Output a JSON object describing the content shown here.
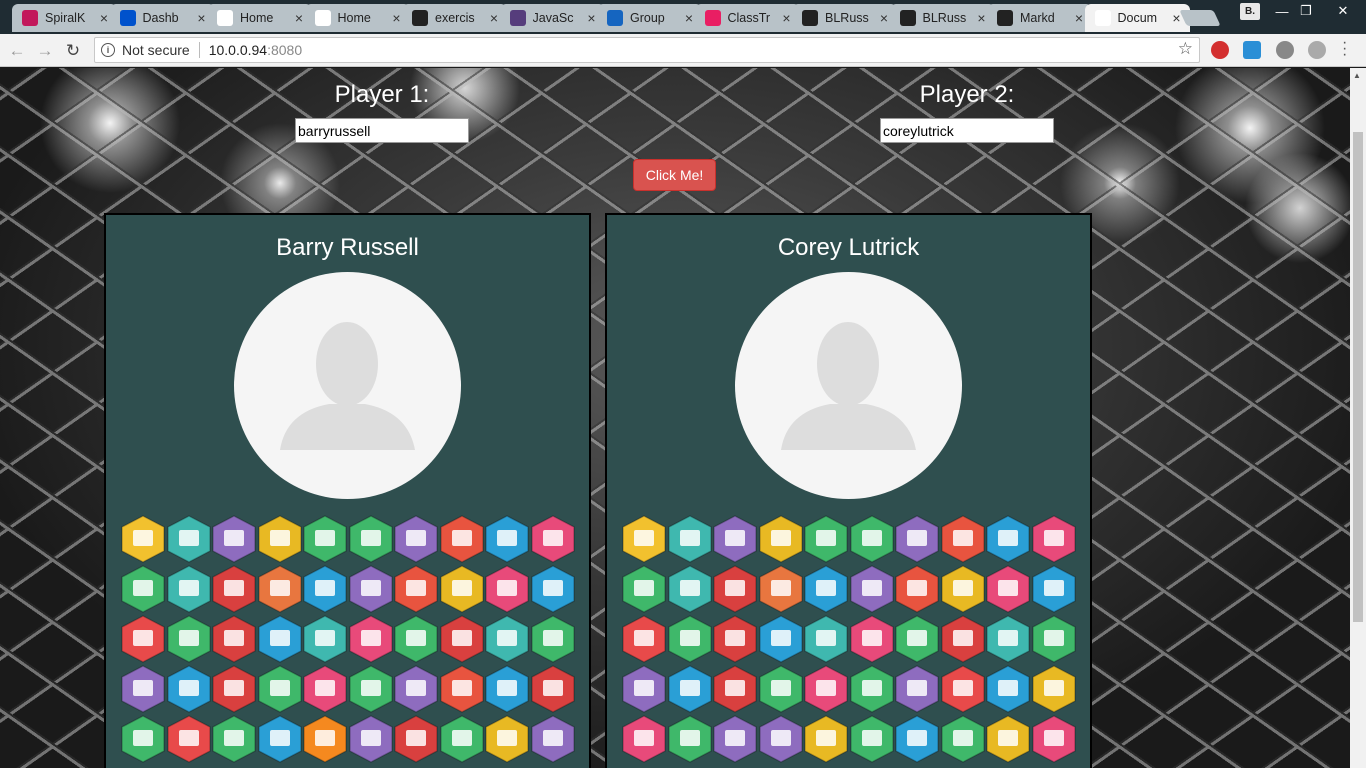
{
  "browser": {
    "tabs": [
      {
        "label": "SpiralK",
        "favicon": "spiral-icon",
        "color": "#c2185b",
        "active": false
      },
      {
        "label": "Dashb",
        "favicon": "atlassian-icon",
        "color": "#0052cc",
        "active": false
      },
      {
        "label": "Home",
        "favicon": "page-icon",
        "color": "#ffffff",
        "active": false
      },
      {
        "label": "Home",
        "favicon": "page-icon",
        "color": "#ffffff",
        "active": false
      },
      {
        "label": "exercis",
        "favicon": "github-icon",
        "color": "#222222",
        "active": false
      },
      {
        "label": "JavaSc",
        "favicon": "bootstrap-icon",
        "color": "#563d7c",
        "active": false
      },
      {
        "label": "Group",
        "favicon": "meetup-icon",
        "color": "#1565c0",
        "active": false
      },
      {
        "label": "ClassTr",
        "favicon": "flamingo-icon",
        "color": "#e91e63",
        "active": false
      },
      {
        "label": "BLRuss",
        "favicon": "github-icon",
        "color": "#222222",
        "active": false
      },
      {
        "label": "BLRuss",
        "favicon": "github-icon",
        "color": "#222222",
        "active": false
      },
      {
        "label": "Markd",
        "favicon": "github-icon",
        "color": "#222222",
        "active": false
      },
      {
        "label": "Docum",
        "favicon": "document-icon",
        "color": "#ffffff",
        "active": true
      }
    ],
    "profile_initial": "B.",
    "address": {
      "security": "Not secure",
      "host": "10.0.0.94",
      "port": ":8080"
    }
  },
  "form": {
    "player1_label": "Player 1:",
    "player1_value": "barryrussell",
    "player2_label": "Player 2:",
    "player2_value": "coreylutrick",
    "button_label": "Click Me!",
    "button_color": "#d9534f"
  },
  "cards": [
    {
      "name": "Barry Russell",
      "badges": [
        "#f2c12e",
        "#3fb8af",
        "#8e6cbf",
        "#e8b923",
        "#3fb86a",
        "#3fb86a",
        "#8e6cbf",
        "#e8543f",
        "#2a9fd6",
        "#e84a7a",
        "#3fb86a",
        "#3fb8af",
        "#d9403f",
        "#e8763f",
        "#2a9fd6",
        "#8e6cbf",
        "#e8543f",
        "#e8b923",
        "#e84a7a",
        "#2a9fd6",
        "#e84a4a",
        "#3fb86a",
        "#d9403f",
        "#2a9fd6",
        "#3fb8af",
        "#e84a7a",
        "#3fb86a",
        "#d9403f",
        "#3fb8af",
        "#3fb86a",
        "#8e6cbf",
        "#2a9fd6",
        "#d9403f",
        "#3fb86a",
        "#e84a7a",
        "#3fb86a",
        "#8e6cbf",
        "#e8543f",
        "#2a9fd6",
        "#d9403f",
        "#3fb86a",
        "#e84a4a",
        "#3fb86a",
        "#2a9fd6",
        "#f5891f",
        "#8e6cbf",
        "#d9403f",
        "#3fb86a",
        "#e8b923",
        "#8e6cbf"
      ]
    },
    {
      "name": "Corey Lutrick",
      "badges": [
        "#f2c12e",
        "#3fb8af",
        "#8e6cbf",
        "#e8b923",
        "#3fb86a",
        "#3fb86a",
        "#8e6cbf",
        "#e8543f",
        "#2a9fd6",
        "#e84a7a",
        "#3fb86a",
        "#3fb8af",
        "#d9403f",
        "#e8763f",
        "#2a9fd6",
        "#8e6cbf",
        "#e8543f",
        "#e8b923",
        "#e84a7a",
        "#2a9fd6",
        "#e84a4a",
        "#3fb86a",
        "#d9403f",
        "#2a9fd6",
        "#3fb8af",
        "#e84a7a",
        "#3fb86a",
        "#d9403f",
        "#3fb8af",
        "#3fb86a",
        "#8e6cbf",
        "#2a9fd6",
        "#d9403f",
        "#3fb86a",
        "#e84a7a",
        "#3fb86a",
        "#8e6cbf",
        "#e84a4a",
        "#2a9fd6",
        "#e8b923",
        "#e84a7a",
        "#3fb86a",
        "#8e6cbf",
        "#8e6cbf",
        "#e8b923",
        "#3fb86a",
        "#2a9fd6",
        "#3fb86a",
        "#e8b923",
        "#e84a7a"
      ]
    }
  ]
}
